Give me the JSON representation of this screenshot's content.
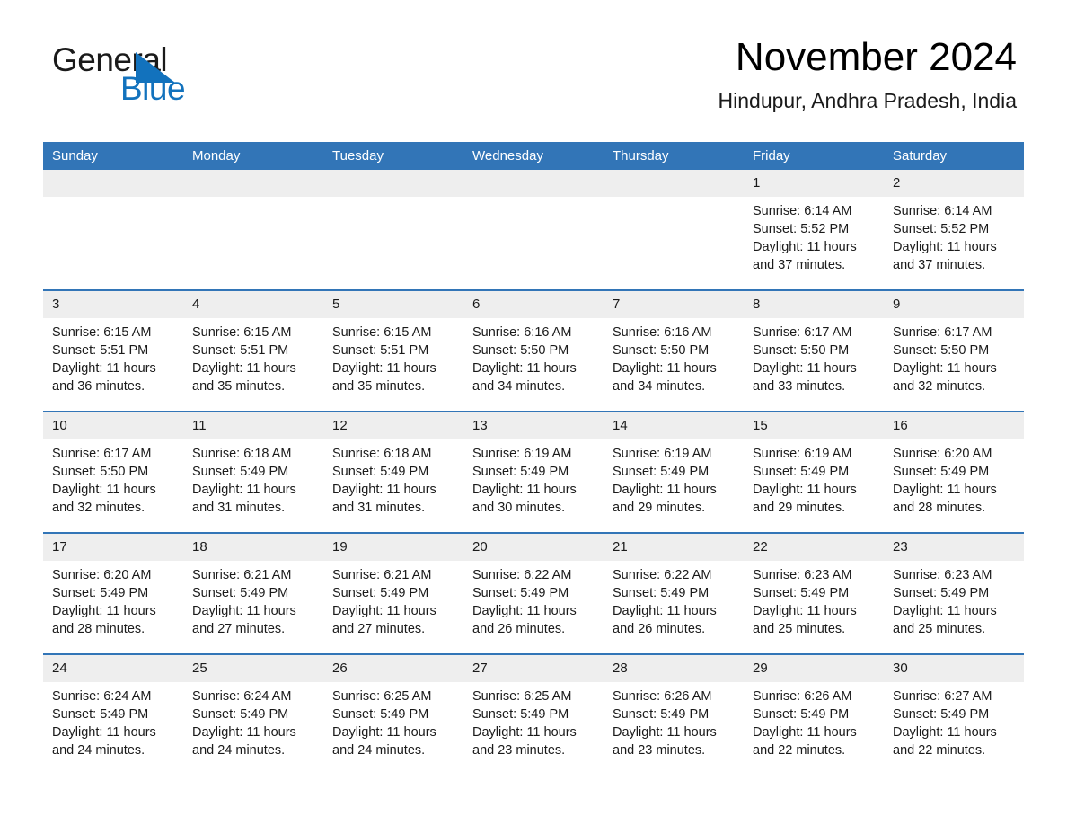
{
  "brand": {
    "word1": "General",
    "word2": "Blue",
    "triangle_color": "#1272bd",
    "logo_icon": "triangle-logo-icon"
  },
  "header": {
    "title": "November 2024",
    "location": "Hindupur, Andhra Pradesh, India"
  },
  "theme": {
    "header_blue": "#3275b7",
    "daynum_gray": "#eeeeee",
    "text_black": "#1a1a1a",
    "brand_blue": "#1272bd"
  },
  "calendar": {
    "weekday_headers": [
      "Sunday",
      "Monday",
      "Tuesday",
      "Wednesday",
      "Thursday",
      "Friday",
      "Saturday"
    ],
    "labels": {
      "sunrise": "Sunrise:",
      "sunset": "Sunset:",
      "daylight": "Daylight:"
    },
    "weeks": [
      [
        {
          "day": "",
          "empty": true
        },
        {
          "day": "",
          "empty": true
        },
        {
          "day": "",
          "empty": true
        },
        {
          "day": "",
          "empty": true
        },
        {
          "day": "",
          "empty": true
        },
        {
          "day": "1",
          "sunrise": "Sunrise: 6:14 AM",
          "sunset": "Sunset: 5:52 PM",
          "daylight_1": "Daylight: 11 hours",
          "daylight_2": "and 37 minutes."
        },
        {
          "day": "2",
          "sunrise": "Sunrise: 6:14 AM",
          "sunset": "Sunset: 5:52 PM",
          "daylight_1": "Daylight: 11 hours",
          "daylight_2": "and 37 minutes."
        }
      ],
      [
        {
          "day": "3",
          "sunrise": "Sunrise: 6:15 AM",
          "sunset": "Sunset: 5:51 PM",
          "daylight_1": "Daylight: 11 hours",
          "daylight_2": "and 36 minutes."
        },
        {
          "day": "4",
          "sunrise": "Sunrise: 6:15 AM",
          "sunset": "Sunset: 5:51 PM",
          "daylight_1": "Daylight: 11 hours",
          "daylight_2": "and 35 minutes."
        },
        {
          "day": "5",
          "sunrise": "Sunrise: 6:15 AM",
          "sunset": "Sunset: 5:51 PM",
          "daylight_1": "Daylight: 11 hours",
          "daylight_2": "and 35 minutes."
        },
        {
          "day": "6",
          "sunrise": "Sunrise: 6:16 AM",
          "sunset": "Sunset: 5:50 PM",
          "daylight_1": "Daylight: 11 hours",
          "daylight_2": "and 34 minutes."
        },
        {
          "day": "7",
          "sunrise": "Sunrise: 6:16 AM",
          "sunset": "Sunset: 5:50 PM",
          "daylight_1": "Daylight: 11 hours",
          "daylight_2": "and 34 minutes."
        },
        {
          "day": "8",
          "sunrise": "Sunrise: 6:17 AM",
          "sunset": "Sunset: 5:50 PM",
          "daylight_1": "Daylight: 11 hours",
          "daylight_2": "and 33 minutes."
        },
        {
          "day": "9",
          "sunrise": "Sunrise: 6:17 AM",
          "sunset": "Sunset: 5:50 PM",
          "daylight_1": "Daylight: 11 hours",
          "daylight_2": "and 32 minutes."
        }
      ],
      [
        {
          "day": "10",
          "sunrise": "Sunrise: 6:17 AM",
          "sunset": "Sunset: 5:50 PM",
          "daylight_1": "Daylight: 11 hours",
          "daylight_2": "and 32 minutes."
        },
        {
          "day": "11",
          "sunrise": "Sunrise: 6:18 AM",
          "sunset": "Sunset: 5:49 PM",
          "daylight_1": "Daylight: 11 hours",
          "daylight_2": "and 31 minutes."
        },
        {
          "day": "12",
          "sunrise": "Sunrise: 6:18 AM",
          "sunset": "Sunset: 5:49 PM",
          "daylight_1": "Daylight: 11 hours",
          "daylight_2": "and 31 minutes."
        },
        {
          "day": "13",
          "sunrise": "Sunrise: 6:19 AM",
          "sunset": "Sunset: 5:49 PM",
          "daylight_1": "Daylight: 11 hours",
          "daylight_2": "and 30 minutes."
        },
        {
          "day": "14",
          "sunrise": "Sunrise: 6:19 AM",
          "sunset": "Sunset: 5:49 PM",
          "daylight_1": "Daylight: 11 hours",
          "daylight_2": "and 29 minutes."
        },
        {
          "day": "15",
          "sunrise": "Sunrise: 6:19 AM",
          "sunset": "Sunset: 5:49 PM",
          "daylight_1": "Daylight: 11 hours",
          "daylight_2": "and 29 minutes."
        },
        {
          "day": "16",
          "sunrise": "Sunrise: 6:20 AM",
          "sunset": "Sunset: 5:49 PM",
          "daylight_1": "Daylight: 11 hours",
          "daylight_2": "and 28 minutes."
        }
      ],
      [
        {
          "day": "17",
          "sunrise": "Sunrise: 6:20 AM",
          "sunset": "Sunset: 5:49 PM",
          "daylight_1": "Daylight: 11 hours",
          "daylight_2": "and 28 minutes."
        },
        {
          "day": "18",
          "sunrise": "Sunrise: 6:21 AM",
          "sunset": "Sunset: 5:49 PM",
          "daylight_1": "Daylight: 11 hours",
          "daylight_2": "and 27 minutes."
        },
        {
          "day": "19",
          "sunrise": "Sunrise: 6:21 AM",
          "sunset": "Sunset: 5:49 PM",
          "daylight_1": "Daylight: 11 hours",
          "daylight_2": "and 27 minutes."
        },
        {
          "day": "20",
          "sunrise": "Sunrise: 6:22 AM",
          "sunset": "Sunset: 5:49 PM",
          "daylight_1": "Daylight: 11 hours",
          "daylight_2": "and 26 minutes."
        },
        {
          "day": "21",
          "sunrise": "Sunrise: 6:22 AM",
          "sunset": "Sunset: 5:49 PM",
          "daylight_1": "Daylight: 11 hours",
          "daylight_2": "and 26 minutes."
        },
        {
          "day": "22",
          "sunrise": "Sunrise: 6:23 AM",
          "sunset": "Sunset: 5:49 PM",
          "daylight_1": "Daylight: 11 hours",
          "daylight_2": "and 25 minutes."
        },
        {
          "day": "23",
          "sunrise": "Sunrise: 6:23 AM",
          "sunset": "Sunset: 5:49 PM",
          "daylight_1": "Daylight: 11 hours",
          "daylight_2": "and 25 minutes."
        }
      ],
      [
        {
          "day": "24",
          "sunrise": "Sunrise: 6:24 AM",
          "sunset": "Sunset: 5:49 PM",
          "daylight_1": "Daylight: 11 hours",
          "daylight_2": "and 24 minutes."
        },
        {
          "day": "25",
          "sunrise": "Sunrise: 6:24 AM",
          "sunset": "Sunset: 5:49 PM",
          "daylight_1": "Daylight: 11 hours",
          "daylight_2": "and 24 minutes."
        },
        {
          "day": "26",
          "sunrise": "Sunrise: 6:25 AM",
          "sunset": "Sunset: 5:49 PM",
          "daylight_1": "Daylight: 11 hours",
          "daylight_2": "and 24 minutes."
        },
        {
          "day": "27",
          "sunrise": "Sunrise: 6:25 AM",
          "sunset": "Sunset: 5:49 PM",
          "daylight_1": "Daylight: 11 hours",
          "daylight_2": "and 23 minutes."
        },
        {
          "day": "28",
          "sunrise": "Sunrise: 6:26 AM",
          "sunset": "Sunset: 5:49 PM",
          "daylight_1": "Daylight: 11 hours",
          "daylight_2": "and 23 minutes."
        },
        {
          "day": "29",
          "sunrise": "Sunrise: 6:26 AM",
          "sunset": "Sunset: 5:49 PM",
          "daylight_1": "Daylight: 11 hours",
          "daylight_2": "and 22 minutes."
        },
        {
          "day": "30",
          "sunrise": "Sunrise: 6:27 AM",
          "sunset": "Sunset: 5:49 PM",
          "daylight_1": "Daylight: 11 hours",
          "daylight_2": "and 22 minutes."
        }
      ]
    ]
  }
}
